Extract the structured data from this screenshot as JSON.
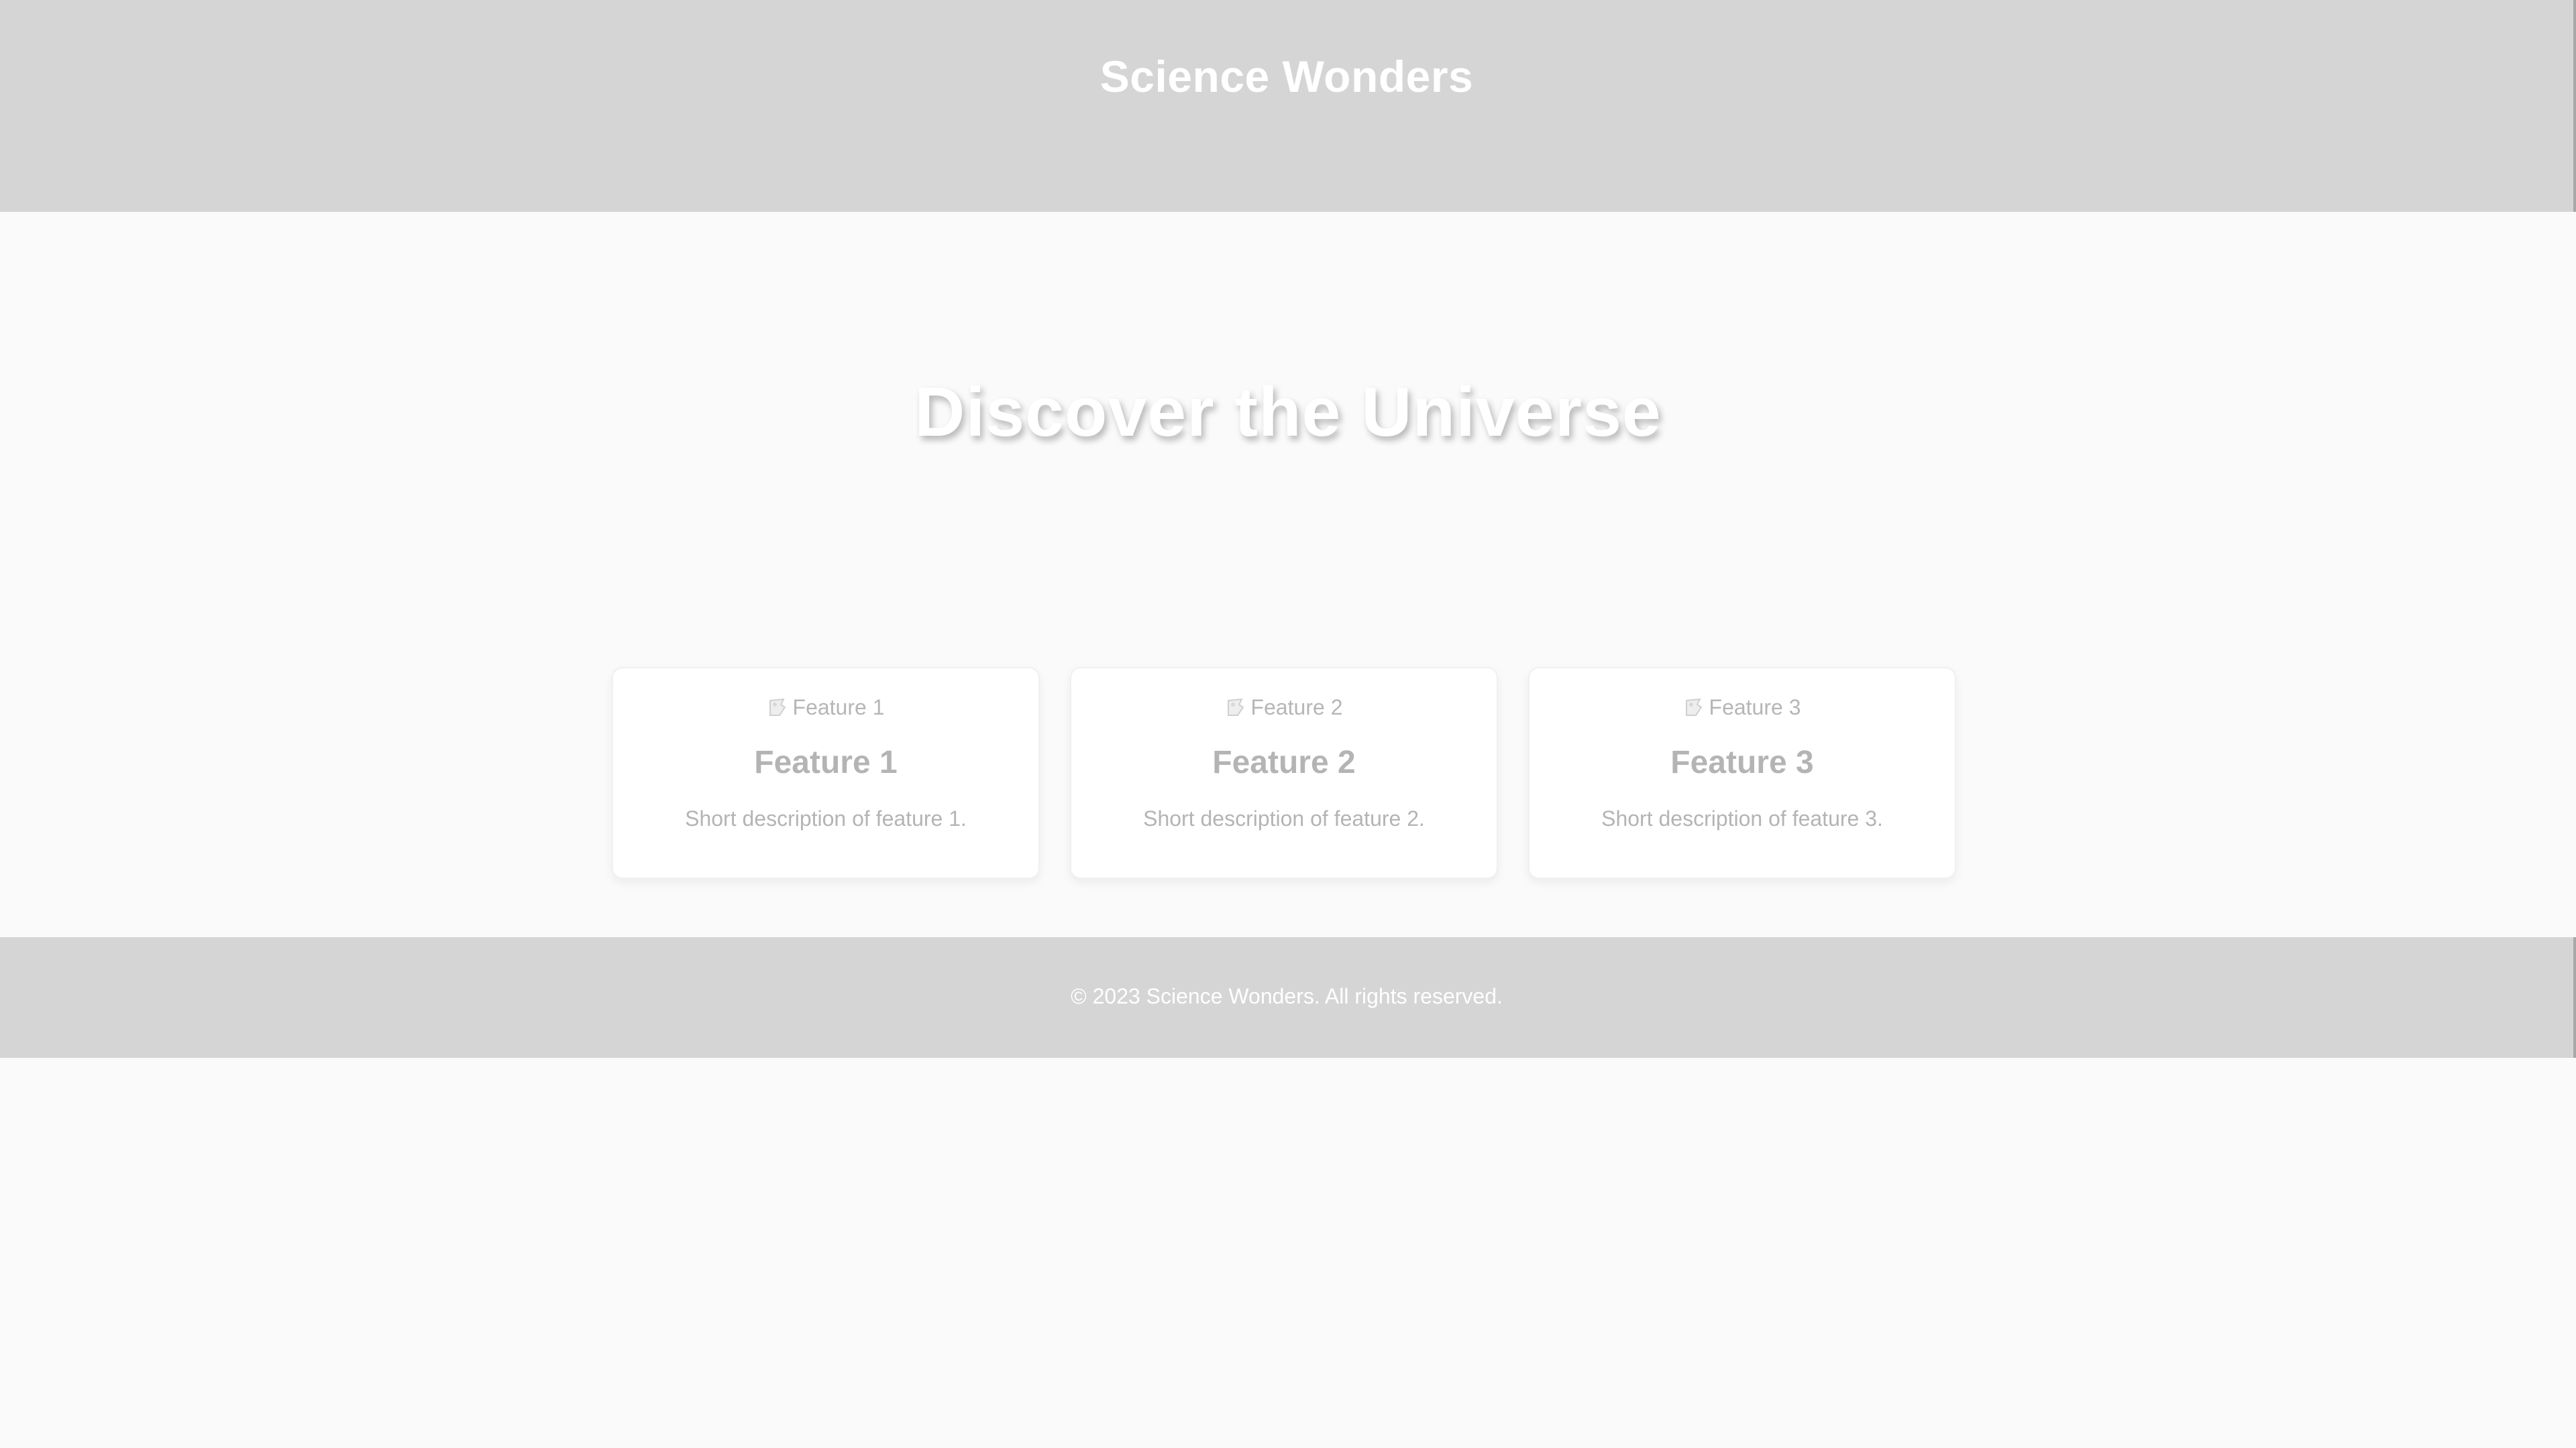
{
  "header": {
    "title": "Science Wonders"
  },
  "hero": {
    "title": "Discover the Universe"
  },
  "features": [
    {
      "image_alt": "Feature 1",
      "title": "Feature 1",
      "description": "Short description of feature 1."
    },
    {
      "image_alt": "Feature 2",
      "title": "Feature 2",
      "description": "Short description of feature 2."
    },
    {
      "image_alt": "Feature 3",
      "title": "Feature 3",
      "description": "Short description of feature 3."
    }
  ],
  "footer": {
    "text": "© 2023 Science Wonders. All rights reserved."
  },
  "colors": {
    "header_bg": "#d5d5d5",
    "page_bg": "#fafafa",
    "card_bg": "#ffffff",
    "muted_text": "#b4b4b4"
  }
}
